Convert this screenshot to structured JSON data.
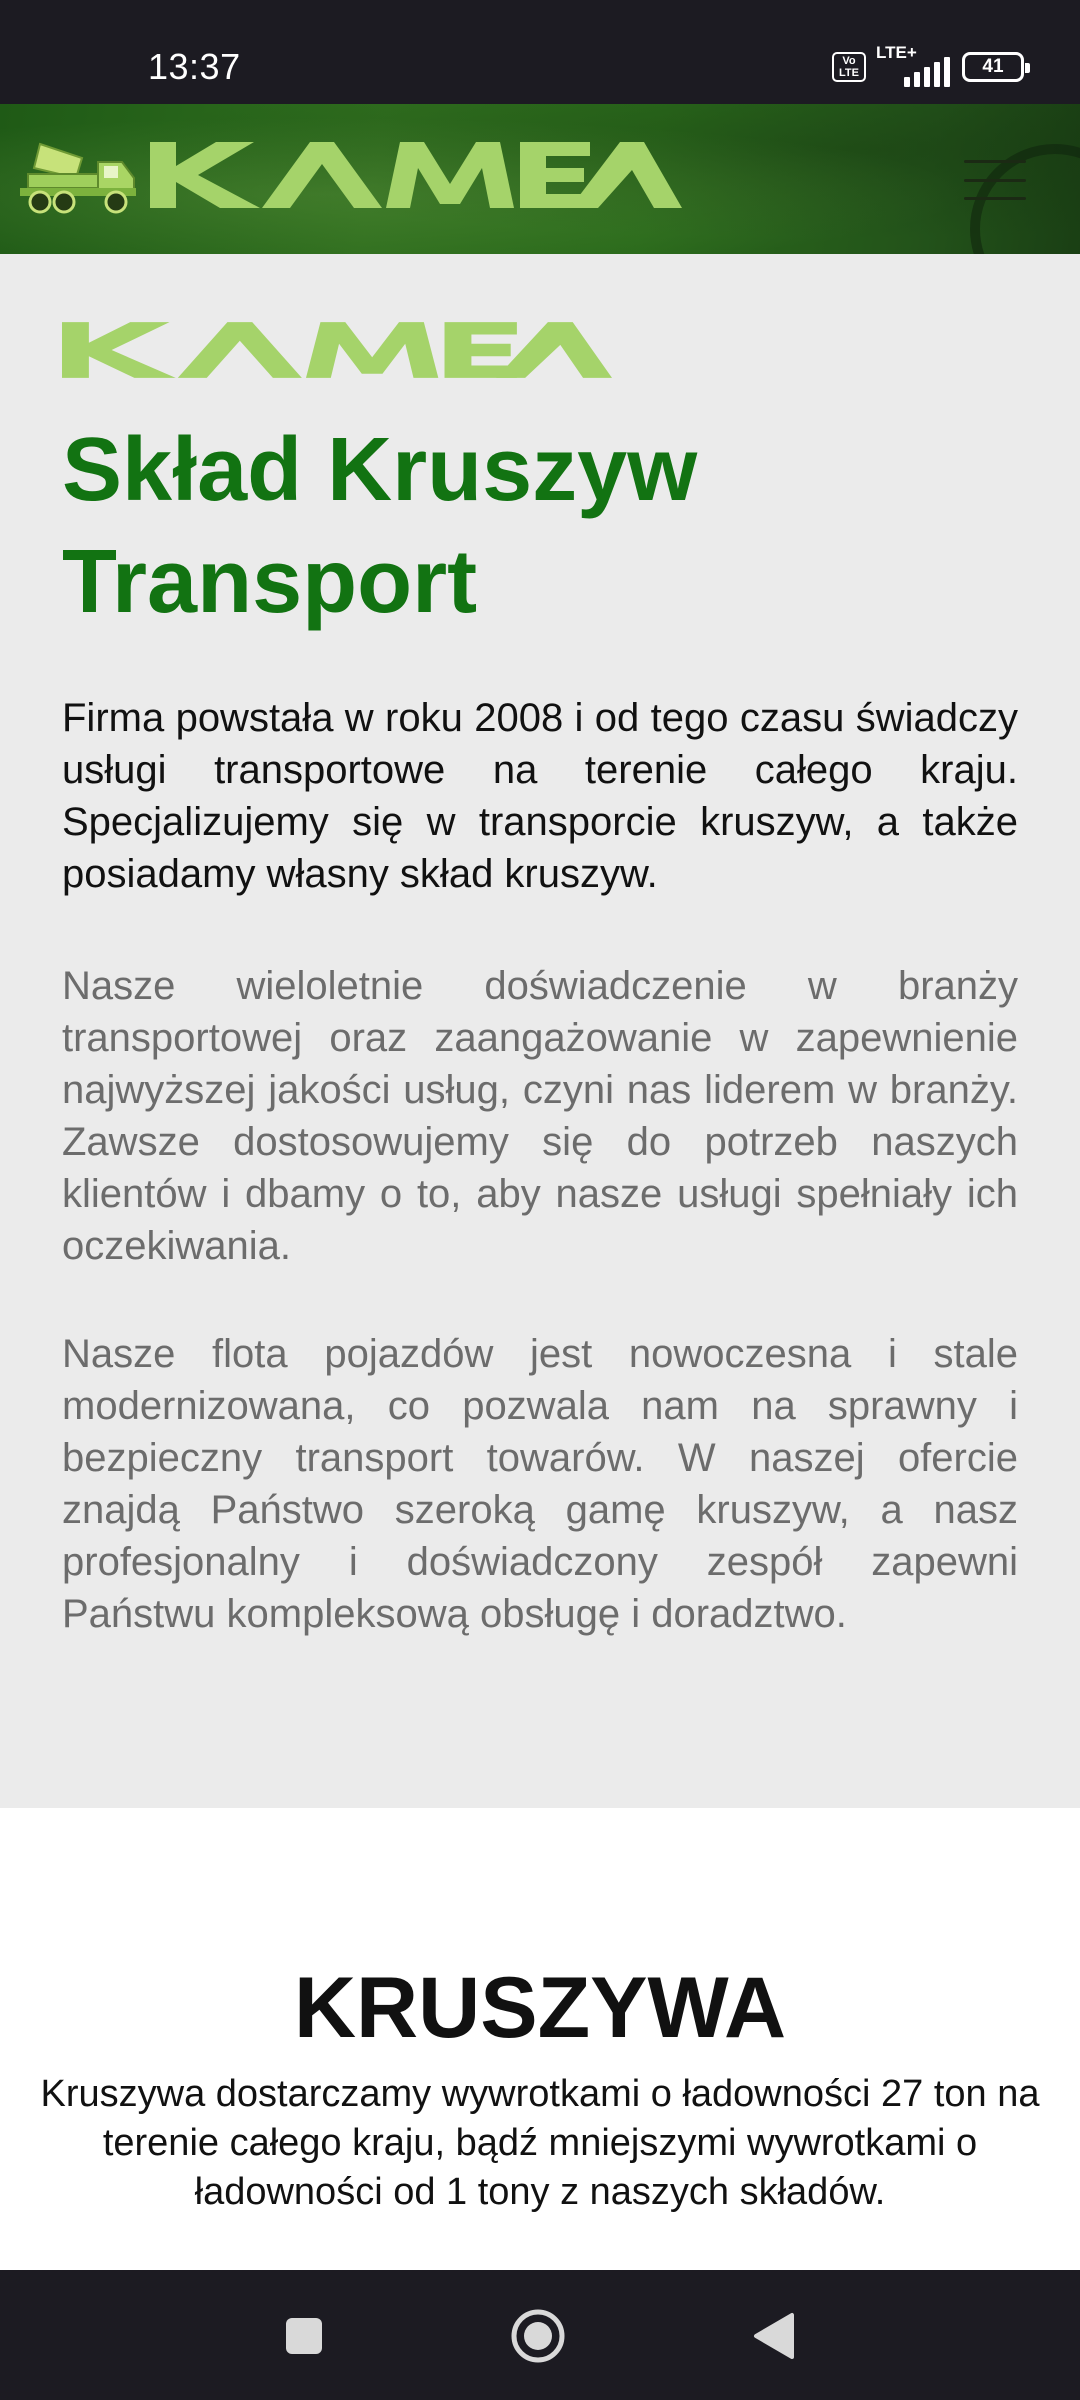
{
  "status_bar": {
    "time": "13:37",
    "volte": "Vo LTE",
    "network": "LTE+",
    "battery": "41"
  },
  "header": {
    "logo_text": "KAMEA",
    "logo_color": "#a5d36a",
    "menu_icon": "hamburger-icon",
    "truck_icon": "dump-truck-icon"
  },
  "intro": {
    "logo_text": "KAMEA",
    "title_line1": "Skład Kruszyw",
    "title_line2": "Transport",
    "title_color": "#127312",
    "paragraph1": "Firma powstała w roku 2008 i od tego czasu świadczy usługi transportowe na terenie całego kraju. Specjalizujemy się w transporcie kruszyw, a także posiadamy własny skład kruszyw.",
    "paragraph2": "Nasze wieloletnie doświadczenie w branży transportowej oraz zaangażowanie w zapewnienie najwyższej jakości usług, czyni nas liderem w branży. Zawsze dostosowujemy się do potrzeb naszych klientów i dbamy o to, aby nasze usługi spełniały ich oczekiwania.",
    "paragraph3": "Nasze flota pojazdów jest nowoczesna i stale modernizowana, co pozwala nam na sprawny i bezpieczny transport towarów. W naszej ofercie znajdą Państwo szeroką gamę kruszyw, a nasz profesjonalny i doświadczony zespół zapewni Państwu kompleksową obsługę i doradztwo."
  },
  "kruszywa": {
    "title": "KRUSZYWA",
    "text": "Kruszywa dostarczamy wywrotkami o ładowności 27 ton na terenie całego kraju, bądź mniejszymi wywrotkami o ładowności od 1 tony z naszych składów."
  },
  "nav_bar": {
    "recents_icon": "square-icon",
    "home_icon": "circle-icon",
    "back_icon": "triangle-back-icon"
  }
}
